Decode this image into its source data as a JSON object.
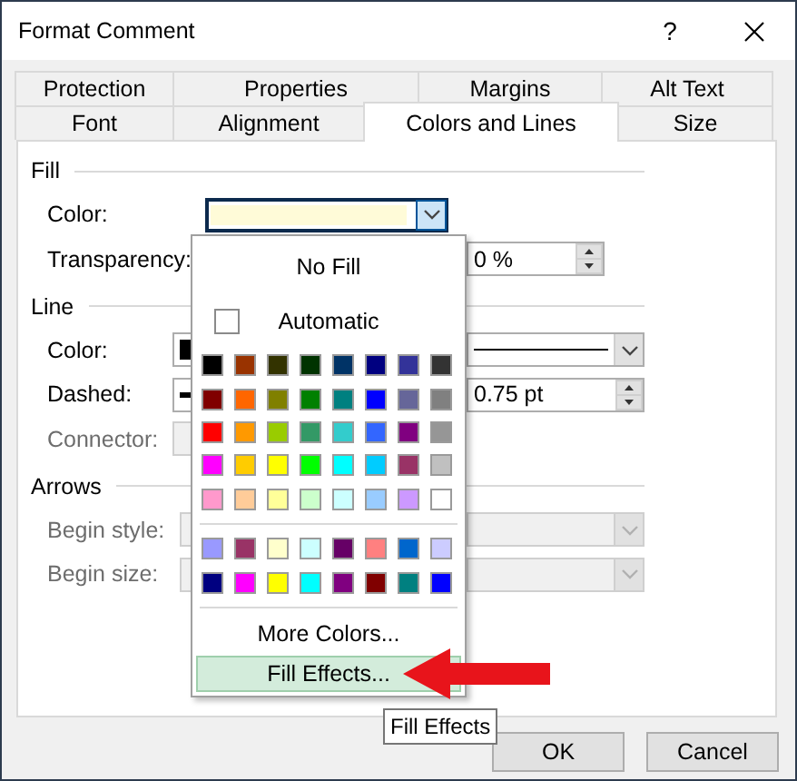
{
  "window": {
    "title": "Format Comment",
    "help": "?"
  },
  "tab_rows": [
    [
      {
        "label": "Protection",
        "selected": false
      },
      {
        "label": "Properties",
        "selected": false
      },
      {
        "label": "Margins",
        "selected": false
      },
      {
        "label": "Alt Text",
        "selected": false
      }
    ],
    [
      {
        "label": "Font",
        "selected": false
      },
      {
        "label": "Alignment",
        "selected": false
      },
      {
        "label": "Colors and Lines",
        "selected": true
      },
      {
        "label": "Size",
        "selected": false
      }
    ]
  ],
  "sections": [
    {
      "title": "Fill",
      "rows": [
        {
          "label": "Color:",
          "disabled": false,
          "left": {
            "kind": "color-combo",
            "color": "#fffbd8",
            "focused": true
          }
        },
        {
          "label": "Transparency:",
          "disabled": false,
          "right": {
            "kind": "spinner",
            "value": "0 %"
          }
        }
      ]
    },
    {
      "title": "Line",
      "rows": [
        {
          "label": "Color:",
          "disabled": false,
          "left": {
            "kind": "color-combo",
            "color": "#000000",
            "focused": false
          },
          "right": {
            "kind": "line-combo"
          }
        },
        {
          "label": "Dashed:",
          "disabled": false,
          "left": {
            "kind": "dash-combo"
          },
          "right": {
            "kind": "spinner",
            "value": "0.75 pt"
          }
        },
        {
          "label": "Connector:",
          "disabled": true,
          "left": {
            "kind": "field"
          }
        }
      ]
    },
    {
      "title": "Arrows",
      "rows": [
        {
          "label": "Begin style:",
          "disabled": true,
          "left": {
            "kind": "combo"
          },
          "right": {
            "kind": "combo"
          }
        },
        {
          "label": "Begin size:",
          "disabled": true,
          "left": {
            "kind": "combo"
          },
          "right": {
            "kind": "combo"
          }
        }
      ]
    }
  ],
  "color_menu": {
    "no_fill": "No Fill",
    "automatic": {
      "label": "Automatic",
      "checked": false
    },
    "palette": [
      [
        {
          "color": "#000000"
        },
        {
          "color": "#993300"
        },
        {
          "color": "#333300"
        },
        {
          "color": "#003300"
        },
        {
          "color": "#003366"
        },
        {
          "color": "#000080"
        },
        {
          "color": "#333399"
        },
        {
          "color": "#333333"
        }
      ],
      [
        {
          "color": "#800000"
        },
        {
          "color": "#ff6600"
        },
        {
          "color": "#808000"
        },
        {
          "color": "#008000"
        },
        {
          "color": "#008080"
        },
        {
          "color": "#0000ff"
        },
        {
          "color": "#666699"
        },
        {
          "color": "#808080"
        }
      ],
      [
        {
          "color": "#ff0000"
        },
        {
          "color": "#ff9900"
        },
        {
          "color": "#99cc00"
        },
        {
          "color": "#339966"
        },
        {
          "color": "#33cccc"
        },
        {
          "color": "#3366ff"
        },
        {
          "color": "#800080"
        },
        {
          "color": "#969696"
        }
      ],
      [
        {
          "color": "#ff00ff"
        },
        {
          "color": "#ffcc00"
        },
        {
          "color": "#ffff00"
        },
        {
          "color": "#00ff00"
        },
        {
          "color": "#00ffff"
        },
        {
          "color": "#00ccff"
        },
        {
          "color": "#993366"
        },
        {
          "color": "#c0c0c0"
        }
      ],
      [
        {
          "color": "#ff99cc"
        },
        {
          "color": "#ffcc99"
        },
        {
          "color": "#ffff99"
        },
        {
          "color": "#ccffcc"
        },
        {
          "color": "#ccffff"
        },
        {
          "color": "#99ccff"
        },
        {
          "color": "#cc99ff"
        },
        {
          "color": "#ffffff"
        }
      ]
    ],
    "custom_palette": [
      [
        {
          "color": "#9999ff"
        },
        {
          "color": "#993366"
        },
        {
          "color": "#ffffcc"
        },
        {
          "color": "#ccffff"
        },
        {
          "color": "#660066"
        },
        {
          "color": "#ff8080"
        },
        {
          "color": "#0066cc"
        },
        {
          "color": "#ccccff"
        }
      ],
      [
        {
          "color": "#000080"
        },
        {
          "color": "#ff00ff"
        },
        {
          "color": "#ffff00"
        },
        {
          "color": "#00ffff"
        },
        {
          "color": "#800080"
        },
        {
          "color": "#800000"
        },
        {
          "color": "#008080"
        },
        {
          "color": "#0000ff"
        }
      ]
    ],
    "commands": [
      {
        "label": "More Colors...",
        "selected": false
      },
      {
        "label": "Fill Effects...",
        "selected": true
      }
    ]
  },
  "tooltip": {
    "text": "Fill Effects"
  },
  "buttons": [
    {
      "label": "OK"
    },
    {
      "label": "Cancel"
    }
  ]
}
